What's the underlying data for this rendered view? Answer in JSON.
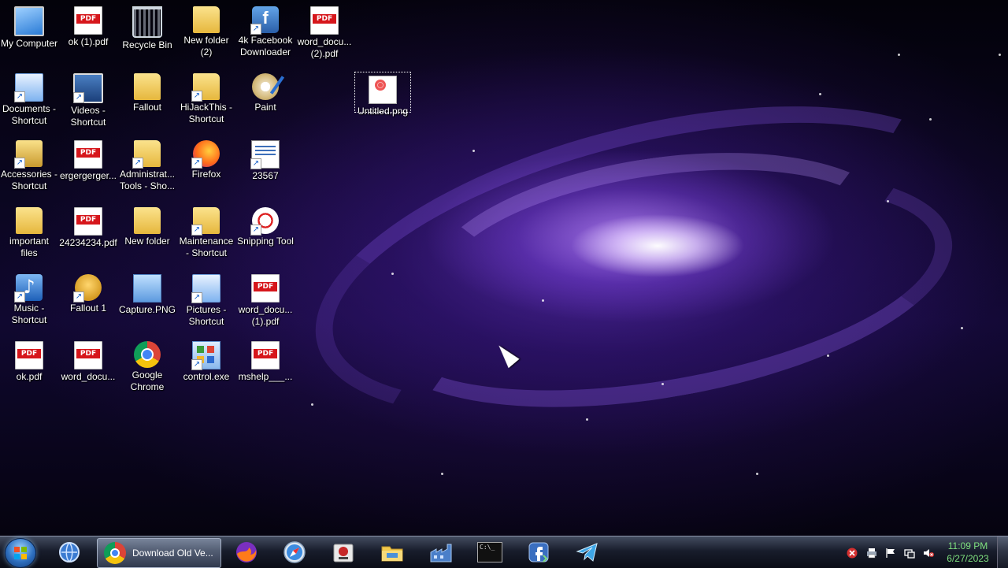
{
  "desktop": {
    "icons": [
      {
        "label": "My Computer"
      },
      {
        "label": "ok (1).pdf"
      },
      {
        "label": "Recycle Bin"
      },
      {
        "label": "New folder (2)"
      },
      {
        "label": "4k Facebook Downloader"
      },
      {
        "label": "word_docu... (2).pdf"
      },
      {
        "label": "Documents - Shortcut"
      },
      {
        "label": "Videos - Shortcut"
      },
      {
        "label": "Fallout"
      },
      {
        "label": "HiJackThis - Shortcut"
      },
      {
        "label": "Paint"
      },
      {
        "label": "Untitled.png"
      },
      {
        "label": "Accessories - Shortcut"
      },
      {
        "label": "ergergerger..."
      },
      {
        "label": "Administrat... Tools - Sho..."
      },
      {
        "label": "Firefox"
      },
      {
        "label": "23567"
      },
      {
        "label": "important files"
      },
      {
        "label": "24234234.pdf"
      },
      {
        "label": "New folder"
      },
      {
        "label": "Maintenance - Shortcut"
      },
      {
        "label": "Snipping Tool"
      },
      {
        "label": "Music - Shortcut"
      },
      {
        "label": "Fallout 1"
      },
      {
        "label": "Capture.PNG"
      },
      {
        "label": "Pictures - Shortcut"
      },
      {
        "label": "word_docu... (1).pdf"
      },
      {
        "label": "ok.pdf"
      },
      {
        "label": "word_docu..."
      },
      {
        "label": "Google Chrome"
      },
      {
        "label": "control.exe"
      },
      {
        "label": "mshelp___..."
      }
    ]
  },
  "taskbar": {
    "active_window_title": "Download Old Ve...",
    "pinned": [
      "network-icon",
      "chrome-icon",
      "firefox-icon",
      "safari-icon",
      "security-app-icon",
      "file-explorer-icon",
      "factory-app-icon",
      "command-prompt-icon",
      "facebook-downloader-icon",
      "telegram-icon"
    ],
    "cmd_glyph": "C:\\_"
  },
  "tray": {
    "icons": [
      "error-x-icon",
      "printer-icon",
      "flag-icon",
      "network-icon",
      "volume-muted-icon"
    ]
  },
  "clock": {
    "time": "11:09 PM",
    "date": "6/27/2023"
  }
}
